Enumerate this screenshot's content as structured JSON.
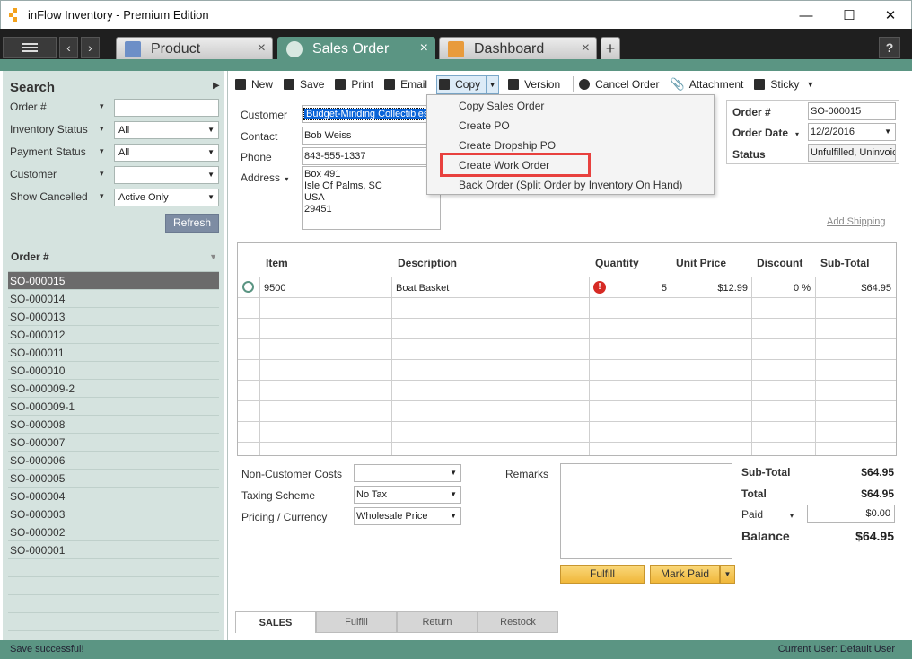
{
  "window": {
    "title": "inFlow Inventory - Premium Edition",
    "minimize": "—",
    "maximize": "☐",
    "close": "✕",
    "help": "?"
  },
  "tabs": [
    {
      "label": "Product",
      "icon": "product-icon"
    },
    {
      "label": "Sales Order",
      "icon": "sales-order-icon"
    },
    {
      "label": "Dashboard",
      "icon": "dashboard-icon"
    }
  ],
  "sidebar": {
    "title": "Search",
    "filters": [
      {
        "label": "Order #",
        "value": ""
      },
      {
        "label": "Inventory Status",
        "value": "All"
      },
      {
        "label": "Payment Status",
        "value": "All"
      },
      {
        "label": "Customer",
        "value": ""
      },
      {
        "label": "Show Cancelled",
        "value": "Active Only"
      }
    ],
    "refresh": "Refresh",
    "list_header": "Order #",
    "orders": [
      "SO-000015",
      "SO-000014",
      "SO-000013",
      "SO-000012",
      "SO-000011",
      "SO-000010",
      "SO-000009-2",
      "SO-000009-1",
      "SO-000008",
      "SO-000007",
      "SO-000006",
      "SO-000005",
      "SO-000004",
      "SO-000003",
      "SO-000002",
      "SO-000001"
    ],
    "selected": "SO-000015"
  },
  "toolbar": {
    "new": "New",
    "save": "Save",
    "print": "Print",
    "email": "Email",
    "copy": "Copy",
    "version": "Version",
    "cancel_order": "Cancel Order",
    "attachment": "Attachment",
    "sticky": "Sticky"
  },
  "copy_menu": [
    "Copy Sales Order",
    "Create PO",
    "Create Dropship PO",
    "Create Work Order",
    "Back Order (Split Order by Inventory On Hand)"
  ],
  "customer": {
    "customer_label": "Customer",
    "customer": "Budget-Minding Collectibles",
    "contact_label": "Contact",
    "contact": "Bob Weiss",
    "phone_label": "Phone",
    "phone": "843-555-1337",
    "address_label": "Address",
    "address": [
      "Box 491",
      "Isle Of Palms, SC",
      "USA",
      "29451"
    ]
  },
  "order": {
    "number_label": "Order #",
    "number": "SO-000015",
    "date_label": "Order Date",
    "date": "12/2/2016",
    "status_label": "Status",
    "status": "Unfulfilled, Uninvoiced"
  },
  "add_shipping": "Add Shipping",
  "grid": {
    "headers": [
      "Item",
      "Description",
      "Quantity",
      "Unit Price",
      "Discount",
      "Sub-Total"
    ],
    "rows": [
      {
        "item": "9500",
        "description": "Boat Basket",
        "quantity": "5",
        "unit_price": "$12.99",
        "discount": "0 %",
        "subtotal": "$64.95"
      }
    ]
  },
  "costs": {
    "non_customer_label": "Non-Customer Costs",
    "non_customer": "",
    "taxing_label": "Taxing Scheme",
    "taxing": "No Tax",
    "pricing_label": "Pricing / Currency",
    "pricing": "Wholesale Price",
    "remarks_label": "Remarks"
  },
  "totals": {
    "subtotal_label": "Sub-Total",
    "subtotal": "$64.95",
    "total_label": "Total",
    "total": "$64.95",
    "paid_label": "Paid",
    "paid": "$0.00",
    "balance_label": "Balance",
    "balance": "$64.95"
  },
  "actions": {
    "fulfill": "Fulfill",
    "mark_paid": "Mark Paid"
  },
  "bottom_tabs": [
    "SALES",
    "Fulfill",
    "Return",
    "Restock"
  ],
  "status": {
    "left": "Save successful!",
    "right": "Current User:  Default User"
  },
  "colors": {
    "accent": "#5b9583",
    "highlight": "#e8413e",
    "selection": "#0a64d8"
  }
}
